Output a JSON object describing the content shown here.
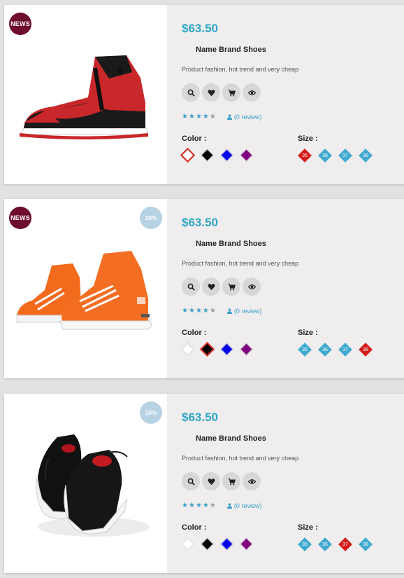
{
  "products": [
    {
      "badge_news": "NEWS",
      "badge_sale": "",
      "image": "red-black-high-top-sneaker",
      "price": "$63.50",
      "title": "Name Brand Shoes",
      "description": "Product fashion, hot trend and very cheap",
      "rating": 4,
      "review_text": "(0 review)",
      "color_label": "Color :",
      "size_label": "Size :",
      "colors": [
        "#ffffff",
        "#000000",
        "#0000ee",
        "#800080"
      ],
      "selected_color": 0,
      "sizes": [
        "35",
        "36",
        "37",
        "38"
      ],
      "selected_size": 0
    },
    {
      "badge_news": "NEWS",
      "badge_sale": "10%",
      "image": "orange-high-top-sneakers",
      "price": "$63.50",
      "title": "Name Brand Shoes",
      "description": "Product fashion, hot trend and very cheap",
      "rating": 4,
      "review_text": "(0 review)",
      "color_label": "Color :",
      "size_label": "Size :",
      "colors": [
        "#ffffff",
        "#000000",
        "#0000ee",
        "#800080"
      ],
      "selected_color": 1,
      "sizes": [
        "35",
        "36",
        "37",
        "38"
      ],
      "selected_size": 3
    },
    {
      "badge_news": "",
      "badge_sale": "10%",
      "image": "black-skate-sneakers",
      "price": "$63.50",
      "title": "Name Brand Shoes",
      "description": "Product fashion, hot trend and very cheap",
      "rating": 4,
      "review_text": "(0 review)",
      "color_label": "Color :",
      "size_label": "Size :",
      "colors": [
        "#ffffff",
        "#000000",
        "#0000ee",
        "#800080"
      ],
      "selected_color": -1,
      "sizes": [
        "35",
        "36",
        "37",
        "38"
      ],
      "selected_size": 2
    }
  ],
  "action_icons": [
    "search-icon",
    "heart-icon",
    "cart-icon",
    "eye-icon"
  ],
  "colors": {
    "accent": "#2fa6c8",
    "size_default": "#3fa9cf",
    "size_selected": "#d41a1a",
    "news_badge": "#6e0d2c",
    "sale_badge": "#b6d2e3"
  }
}
